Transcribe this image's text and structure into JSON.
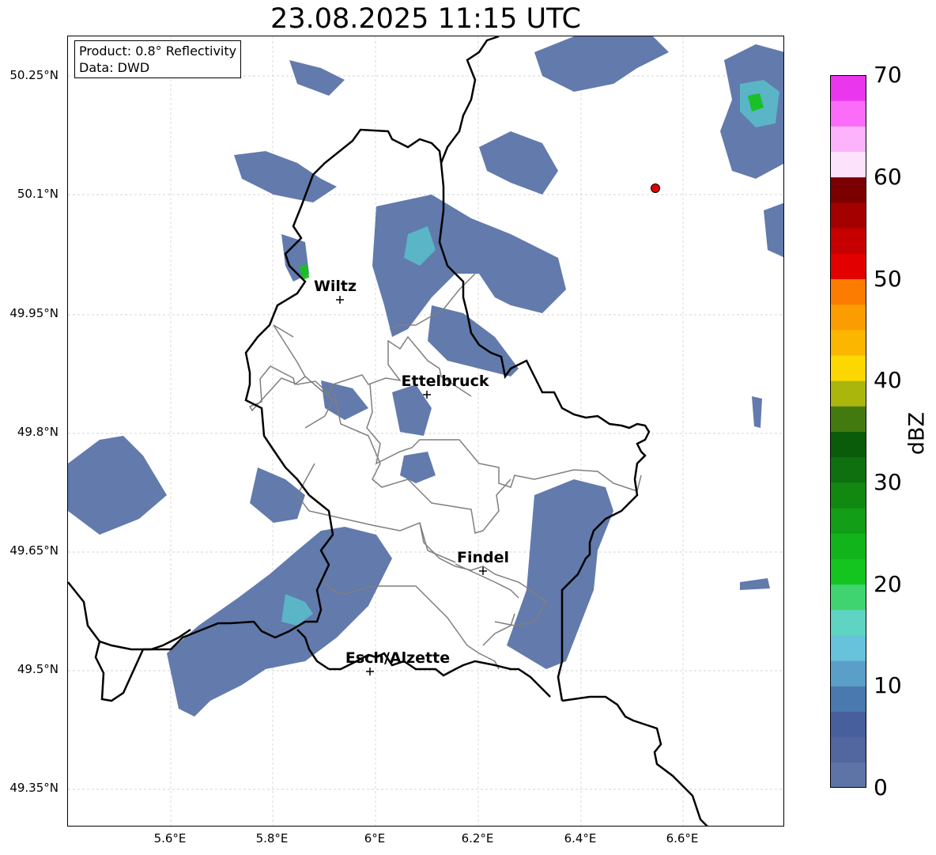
{
  "title": "23.08.2025 11:15 UTC",
  "info_box": {
    "product": "Product: 0.8° Reflectivity",
    "data": "Data: DWD"
  },
  "lat_ticks": [
    "50.25°N",
    "50.1°N",
    "49.95°N",
    "49.8°N",
    "49.65°N",
    "49.5°N",
    "49.35°N"
  ],
  "lon_ticks": [
    "5.6°E",
    "5.8°E",
    "6°E",
    "6.2°E",
    "6.4°E",
    "6.6°E"
  ],
  "cities": [
    {
      "name": "Wiltz"
    },
    {
      "name": "Ettelbruck"
    },
    {
      "name": "Findel"
    },
    {
      "name": "Esch/Alzette"
    }
  ],
  "colorbar": {
    "label": "dBZ",
    "ticks": [
      "0",
      "10",
      "20",
      "30",
      "40",
      "50",
      "60",
      "70"
    ],
    "colors": [
      "#5f74a6",
      "#52669f",
      "#475f9c",
      "#4a79b0",
      "#5a9fc8",
      "#67c2dc",
      "#5fd4c2",
      "#40d470",
      "#15c51f",
      "#12b41c",
      "#129e16",
      "#11880f",
      "#0e700e",
      "#0a5c0a",
      "#437a10",
      "#abb60d",
      "#fcd800",
      "#fbb700",
      "#fb9c00",
      "#fb7c00",
      "#e20000",
      "#c60000",
      "#a40000",
      "#7a0000",
      "#fde2fb",
      "#fcb3fb",
      "#fa6cf9",
      "#ea37ee"
    ]
  },
  "colors": {
    "rain_light": "#5a73a8",
    "rain_medium": "#5ab8c8",
    "rain_heavy": "#18c020",
    "border_country": "#000000",
    "border_canton": "#7f7f7f",
    "radar_site": "#e00000"
  }
}
